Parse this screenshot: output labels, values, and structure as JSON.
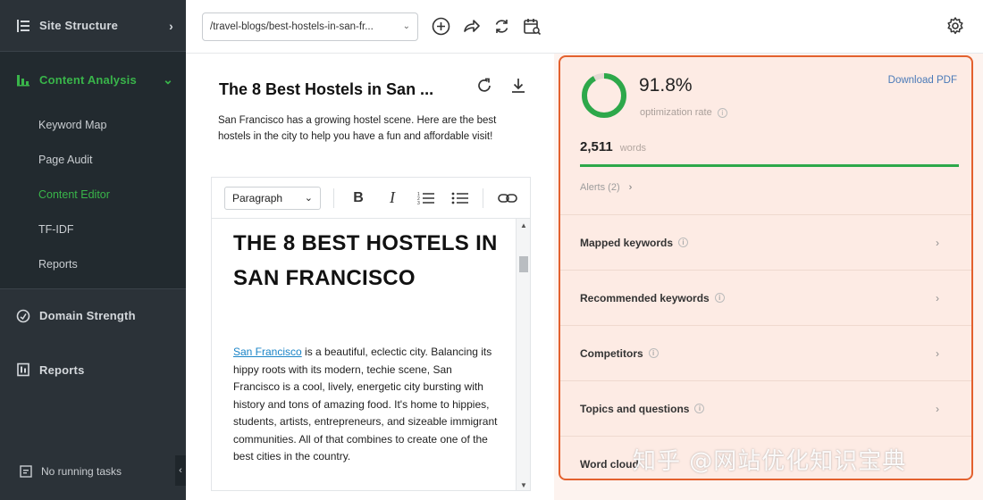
{
  "sidebar": {
    "site_structure": "Site Structure",
    "content_analysis": "Content Analysis",
    "sub_items": [
      "Keyword Map",
      "Page Audit",
      "Content Editor",
      "TF-IDF",
      "Reports"
    ],
    "domain_strength": "Domain Strength",
    "reports": "Reports",
    "no_running_tasks": "No running tasks",
    "active_color": "#39b54a"
  },
  "topbar": {
    "url_value": "/travel-blogs/best-hostels-in-san-fr..."
  },
  "editor": {
    "title": "The 8 Best Hostels in San ...",
    "description": "San Francisco has a growing hostel scene. Here are the best hostels in the city to help you have a fun and affordable visit!",
    "block_format": "Paragraph",
    "doc_heading": "THE 8 BEST HOSTELS IN SAN FRANCISCO",
    "doc_link": "San Francisco",
    "doc_body": " is a beautiful, eclectic city. Balancing its hippy roots with its modern, techie scene, San Francisco is a cool, lively, energetic city bursting with history and tons of amazing food. It's home to hippies, students, artists, entrepreneurs, and sizeable immigrant communities. All of that combines to create one of the best cities in the country."
  },
  "panel": {
    "optimization_rate": "91.8%",
    "optimization_fraction": 0.918,
    "optimization_label": "optimization rate",
    "download_pdf": "Download PDF",
    "word_count": "2,511",
    "words_label": "words",
    "words_progress": 1.0,
    "alerts": "Alerts (2)",
    "sections": [
      "Mapped keywords",
      "Recommended keywords",
      "Competitors",
      "Topics and questions",
      "Word cloud"
    ],
    "accent_color": "#e3612e",
    "progress_color": "#2da84a"
  },
  "watermark": "知乎 @网站优化知识宝典"
}
